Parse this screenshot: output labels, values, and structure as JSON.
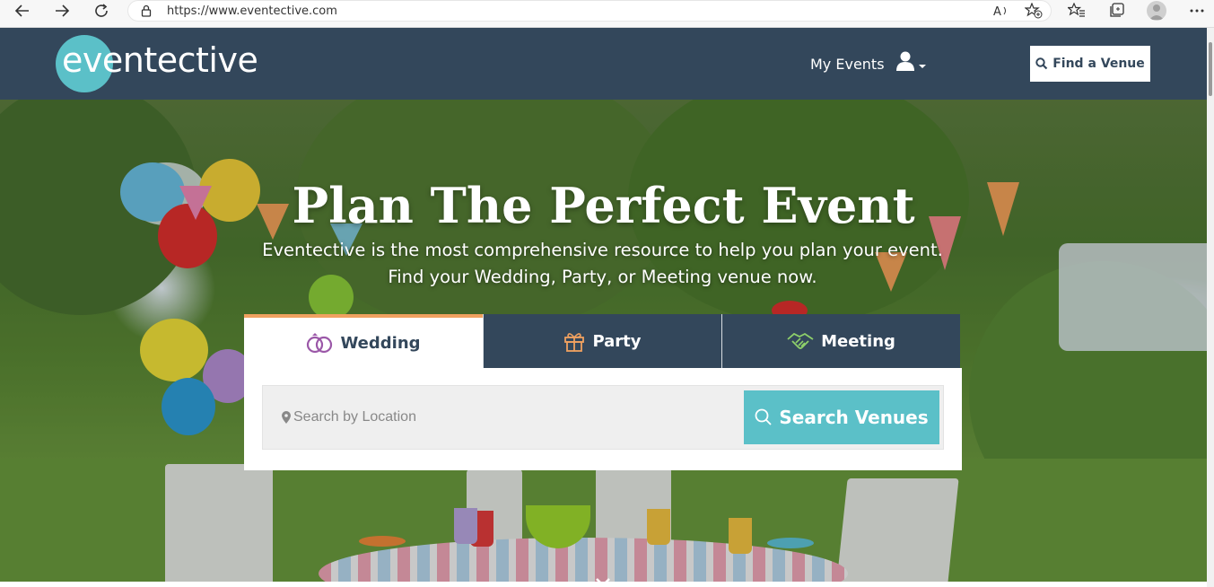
{
  "browser": {
    "url": "https://www.eventective.com",
    "icons": [
      "back-arrow-icon",
      "forward-arrow-icon",
      "refresh-icon",
      "lock-icon",
      "read-aloud-icon",
      "add-favorite-icon",
      "favorites-icon",
      "collections-icon",
      "profile-icon",
      "more-icon"
    ]
  },
  "header": {
    "logo_text": "eventective",
    "my_events": "My Events",
    "find_venue": "Find a Venue",
    "user_icon": "user-icon"
  },
  "hero": {
    "title": "Plan The Perfect Event",
    "subtitle_line1": "Eventective is the most comprehensive resource to help you plan your event.",
    "subtitle_line2": "Find your Wedding, Party, or Meeting venue now."
  },
  "search": {
    "tabs": [
      {
        "label": "Wedding",
        "icon": "rings-icon",
        "active": true
      },
      {
        "label": "Party",
        "icon": "gift-icon",
        "active": false
      },
      {
        "label": "Meeting",
        "icon": "handshake-icon",
        "active": false
      }
    ],
    "placeholder": "Search by Location",
    "button": "Search Venues"
  },
  "colors": {
    "navy": "#33475b",
    "teal": "#5bc0c8",
    "orange_accent": "#f0a160"
  }
}
